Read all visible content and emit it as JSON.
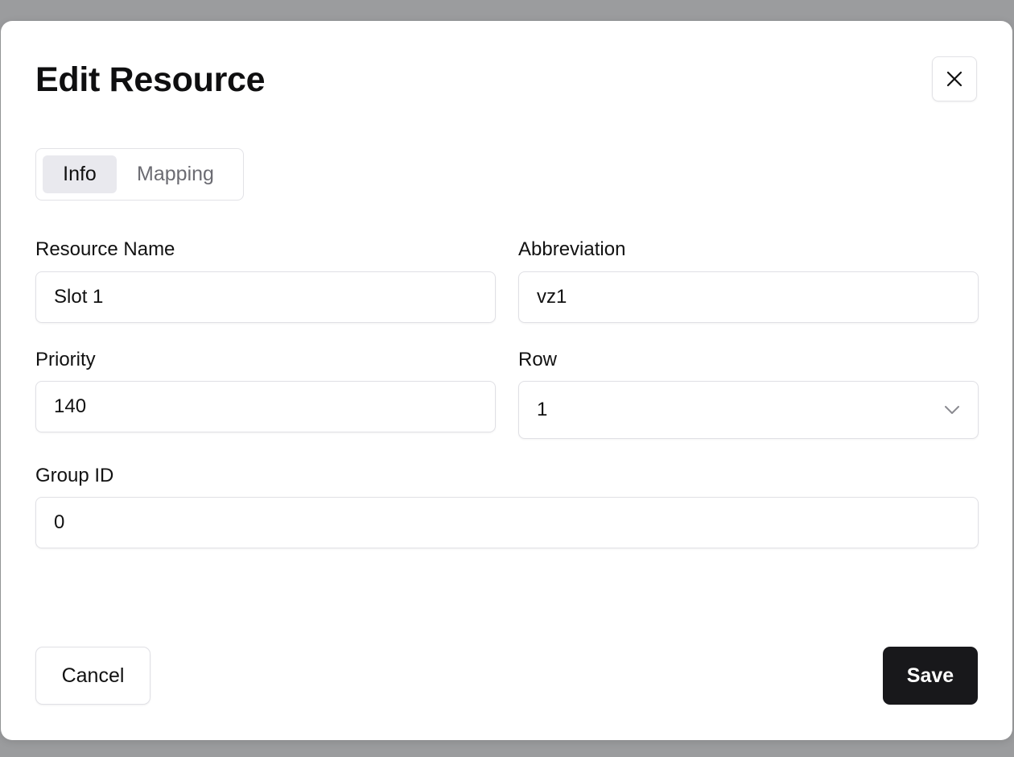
{
  "dialog": {
    "title": "Edit Resource",
    "close_icon": "close-icon"
  },
  "tabs": [
    {
      "label": "Info",
      "active": true
    },
    {
      "label": "Mapping",
      "active": false
    }
  ],
  "form": {
    "resource_name": {
      "label": "Resource Name",
      "value": "Slot 1"
    },
    "abbreviation": {
      "label": "Abbreviation",
      "value": "vz1"
    },
    "priority": {
      "label": "Priority",
      "value": "140"
    },
    "row": {
      "label": "Row",
      "value": "1",
      "icon": "chevron-down-icon"
    },
    "group_id": {
      "label": "Group ID",
      "value": "0"
    }
  },
  "footer": {
    "cancel_label": "Cancel",
    "save_label": "Save"
  },
  "colors": {
    "primary_button": "#18181b",
    "active_tab_bg": "#e9e9ee",
    "inactive_tab_text": "#6b6b72",
    "backdrop": "#9b9c9e"
  }
}
